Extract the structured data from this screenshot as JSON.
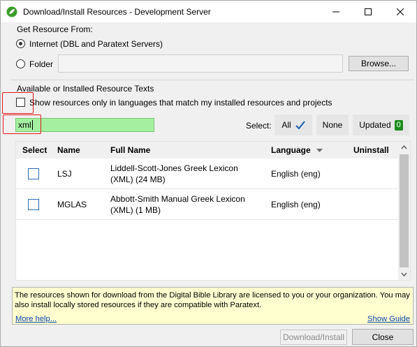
{
  "window": {
    "title": "Download/Install Resources - Development Server",
    "app_icon": "paratext-leaf-icon",
    "controls": [
      "minimize-icon",
      "maximize-icon",
      "close-icon"
    ]
  },
  "source_group": {
    "label": "Get Resource From:",
    "internet_label": "Internet (DBL and Paratext Servers)",
    "internet_selected": true,
    "folder_label": "Folder",
    "folder_path": "",
    "browse_label": "Browse..."
  },
  "texts_group": {
    "label": "Available or Installed Resource Texts",
    "filter_checkbox_label": "Show resources only in languages that match my installed resources and projects",
    "filter_checked": false,
    "search_value": "xml",
    "select_label": "Select:",
    "all_label": "All",
    "none_label": "None",
    "updated_label": "Updated",
    "updated_count": "0"
  },
  "grid": {
    "headers": {
      "select": "Select",
      "name": "Name",
      "full_name": "Full Name",
      "language": "Language",
      "uninstall": "Uninstall"
    },
    "rows": [
      {
        "name": "LSJ",
        "full_name_line1": "Liddell-Scott-Jones Greek Lexicon",
        "full_name_line2": "(XML) (24 MB)",
        "language": "English (eng)",
        "selected": false
      },
      {
        "name": "MGLAS",
        "full_name_line1": "Abbott-Smith Manual Greek Lexicon",
        "full_name_line2": "(XML) (1 MB)",
        "language": "English (eng)",
        "selected": false
      }
    ]
  },
  "info": {
    "text": "The resources shown for download from the Digital Bible Library are licensed to you or your organization. You may also install locally stored resources if they are compatible with Paratext.",
    "more_help": "More help...",
    "show_guide": "Show Guide"
  },
  "footer": {
    "download_label": "Download/Install",
    "close_label": "Close"
  },
  "colors": {
    "search_highlight": "#a4f0a0",
    "info_background": "#ffffd0",
    "annotation_red": "#e2191b",
    "updated_badge": "#1e8c1e",
    "checkmark_blue": "#1a5fb4"
  }
}
